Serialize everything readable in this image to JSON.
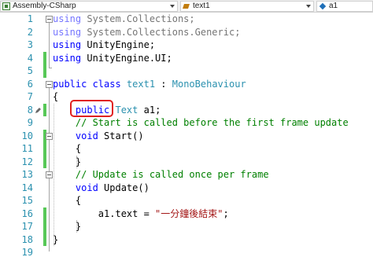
{
  "navbar": {
    "project": "Assembly-CSharp",
    "class_name": "text1",
    "member": "a1"
  },
  "editor": {
    "lines": [
      {
        "n": "1",
        "tokens": [
          {
            "t": "using ",
            "c": "kw faded"
          },
          {
            "t": "System.Collections;",
            "c": "faded"
          }
        ]
      },
      {
        "n": "2",
        "tokens": [
          {
            "t": "using ",
            "c": "kw faded"
          },
          {
            "t": "System.Collections.Generic;",
            "c": "faded"
          }
        ]
      },
      {
        "n": "3",
        "tokens": [
          {
            "t": "using ",
            "c": "kw"
          },
          {
            "t": "UnityEngine;",
            "c": ""
          }
        ]
      },
      {
        "n": "4",
        "tokens": [
          {
            "t": "using ",
            "c": "kw"
          },
          {
            "t": "UnityEngine.UI;",
            "c": ""
          }
        ]
      },
      {
        "n": "5",
        "tokens": []
      },
      {
        "n": "6",
        "tokens": [
          {
            "t": "public ",
            "c": "kw"
          },
          {
            "t": "class ",
            "c": "kw"
          },
          {
            "t": "text1",
            "c": "ty"
          },
          {
            "t": " : ",
            "c": ""
          },
          {
            "t": "MonoBehaviour",
            "c": "ty"
          }
        ]
      },
      {
        "n": "7",
        "tokens": [
          {
            "t": "{",
            "c": ""
          }
        ]
      },
      {
        "n": "8",
        "tokens": [
          {
            "t": "    ",
            "c": ""
          },
          {
            "t": "public ",
            "c": "kw"
          },
          {
            "t": "Text",
            "c": "ty"
          },
          {
            "t": " a1;",
            "c": ""
          }
        ]
      },
      {
        "n": "9",
        "tokens": [
          {
            "t": "    ",
            "c": ""
          },
          {
            "t": "// Start is called before the first frame update",
            "c": "cm"
          }
        ]
      },
      {
        "n": "10",
        "tokens": [
          {
            "t": "    ",
            "c": ""
          },
          {
            "t": "void ",
            "c": "kw"
          },
          {
            "t": "Start()",
            "c": ""
          }
        ]
      },
      {
        "n": "11",
        "tokens": [
          {
            "t": "    {",
            "c": ""
          }
        ]
      },
      {
        "n": "12",
        "tokens": [
          {
            "t": "    }",
            "c": ""
          }
        ]
      },
      {
        "n": "13",
        "tokens": [
          {
            "t": "    ",
            "c": ""
          },
          {
            "t": "// Update is called once per frame",
            "c": "cm"
          }
        ]
      },
      {
        "n": "14",
        "tokens": [
          {
            "t": "    ",
            "c": ""
          },
          {
            "t": "void ",
            "c": "kw"
          },
          {
            "t": "Update()",
            "c": ""
          }
        ]
      },
      {
        "n": "15",
        "tokens": [
          {
            "t": "    {",
            "c": ""
          }
        ]
      },
      {
        "n": "16",
        "tokens": [
          {
            "t": "        a1.text = ",
            "c": ""
          },
          {
            "t": "\"一分鐘後結束\"",
            "c": "st"
          },
          {
            "t": ";",
            "c": ""
          }
        ]
      },
      {
        "n": "17",
        "tokens": [
          {
            "t": "    }",
            "c": ""
          }
        ]
      },
      {
        "n": "18",
        "tokens": [
          {
            "t": "}",
            "c": ""
          }
        ]
      },
      {
        "n": "19",
        "tokens": []
      }
    ]
  }
}
